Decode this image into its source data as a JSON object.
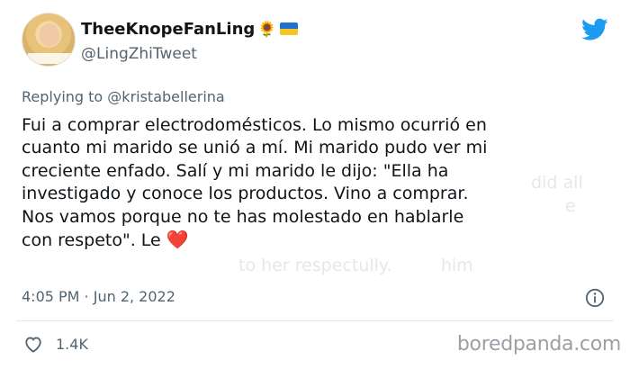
{
  "author": {
    "display_name": "TheeKnopeFanLing",
    "name_emoji": "🌻",
    "handle": "@LingZhiTweet"
  },
  "icons": {
    "brand": "twitter-bird-icon",
    "flag": "ukraine-flag-icon",
    "info": "info-icon",
    "like": "heart-outline-icon"
  },
  "reply": {
    "prefix": "Replying to",
    "mention": "@kristabellerina"
  },
  "body": {
    "lines": [
      "Fui a comprar electrodomésticos. Lo mismo ocurrió en",
      "cuanto mi marido se unió a mí. Mi marido pudo ver mi",
      "creciente enfado. Salí y mi marido le dijo: \"Ella ha",
      "investigado y conoce los productos. Vino a comprar.",
      "Nos vamos porque no te has molestado en hablarle",
      "con respeto\". Le"
    ],
    "heart_emoji": "❤️"
  },
  "timestamp": "4:05 PM · Jun 2, 2022",
  "likes": "1.4K",
  "watermark": "boredpanda.com",
  "colors": {
    "text": "#0f1419",
    "muted": "#536471",
    "twitter_blue": "#1d9bf0",
    "heart": "#e0245e"
  }
}
